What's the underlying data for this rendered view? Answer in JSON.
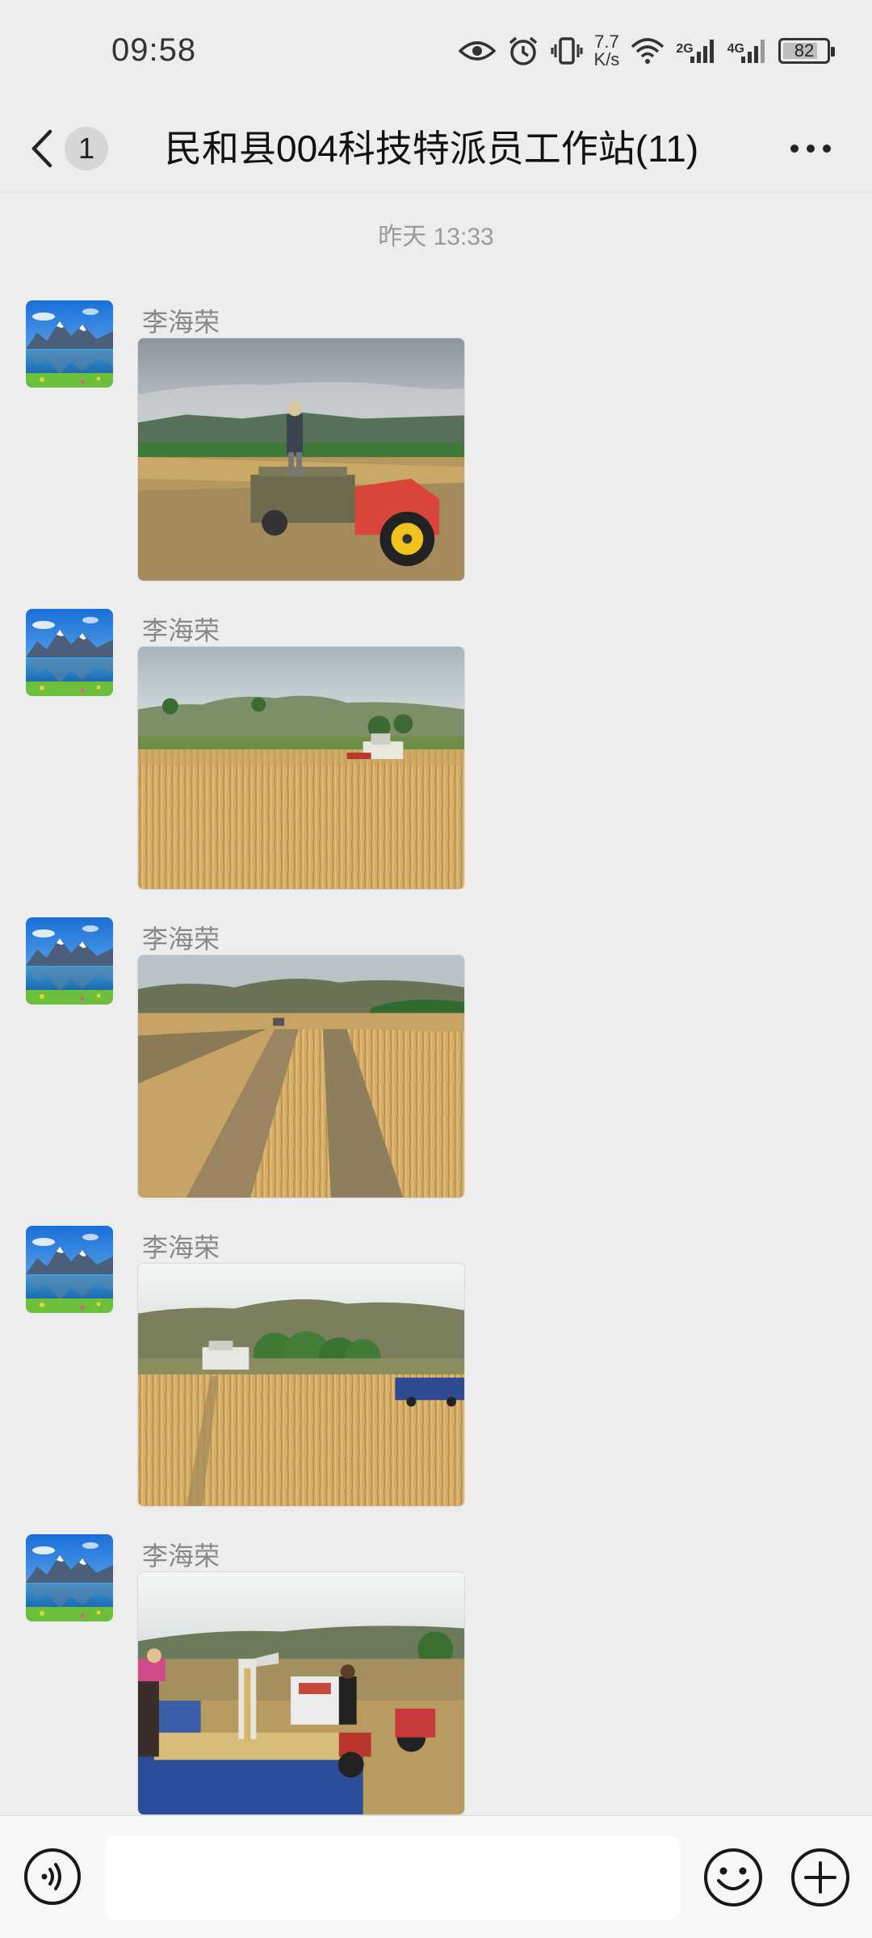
{
  "status_bar": {
    "time": "09:58",
    "net_speed_value": "7.7",
    "net_speed_unit": "K/s",
    "sim1_tag": "2G",
    "sim2_tag": "4G",
    "battery": "82",
    "battery_level": 0.82
  },
  "header": {
    "unread_count": "1",
    "title": "民和县004科技特派员工作站(11)"
  },
  "chat": {
    "timestamp": "昨天 13:33",
    "messages": [
      {
        "sender": "李海荣",
        "type": "image",
        "content": "photo-tractor-wheat-field"
      },
      {
        "sender": "李海荣",
        "type": "image",
        "content": "photo-harvester-wheat-field"
      },
      {
        "sender": "李海荣",
        "type": "image",
        "content": "photo-harvested-rows"
      },
      {
        "sender": "李海荣",
        "type": "image",
        "content": "photo-harvester-hills"
      },
      {
        "sender": "李海荣",
        "type": "image",
        "content": "photo-grain-unloading"
      }
    ]
  },
  "input_bar": {
    "placeholder": "",
    "voice_icon": "voice-icon",
    "emoji_icon": "emoji-icon",
    "plus_icon": "plus-icon"
  },
  "colors": {
    "background": "#ededed",
    "input_bar": "#f7f7f7",
    "sender_name": "#888888"
  }
}
